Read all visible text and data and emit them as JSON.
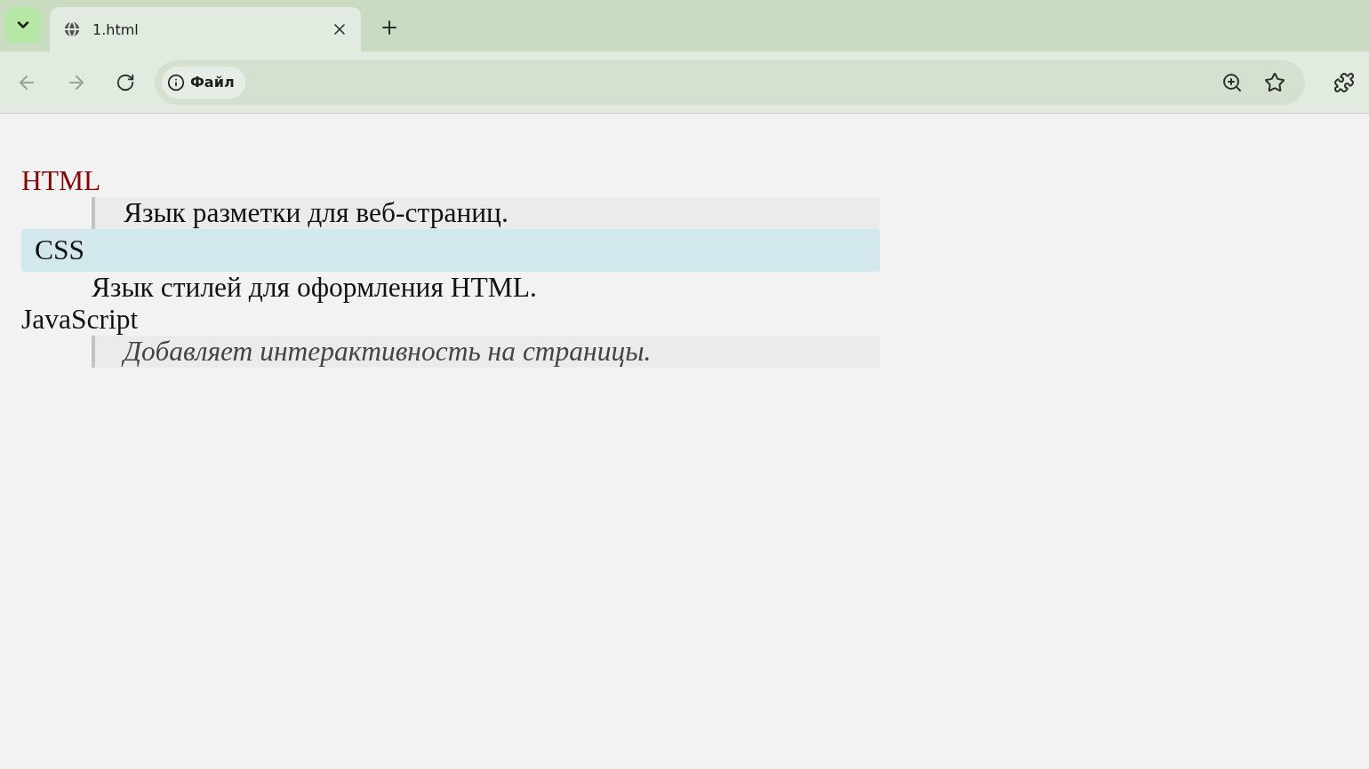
{
  "browser": {
    "tab": {
      "title": "1.html"
    },
    "address_bar": {
      "chip": "Файл"
    }
  },
  "definitions": [
    {
      "kind": "accent",
      "term": "HTML",
      "description": {
        "kind": "quote",
        "text": "Язык разметки для веб-страниц."
      }
    },
    {
      "kind": "highlight",
      "term": "CSS",
      "description": {
        "kind": "plain",
        "text": "Язык стилей для оформления HTML."
      }
    },
    {
      "kind": "plain",
      "term": "JavaScript",
      "description": {
        "kind": "quote-italic",
        "text": "Добавляет интерактивность на страницы."
      }
    }
  ]
}
